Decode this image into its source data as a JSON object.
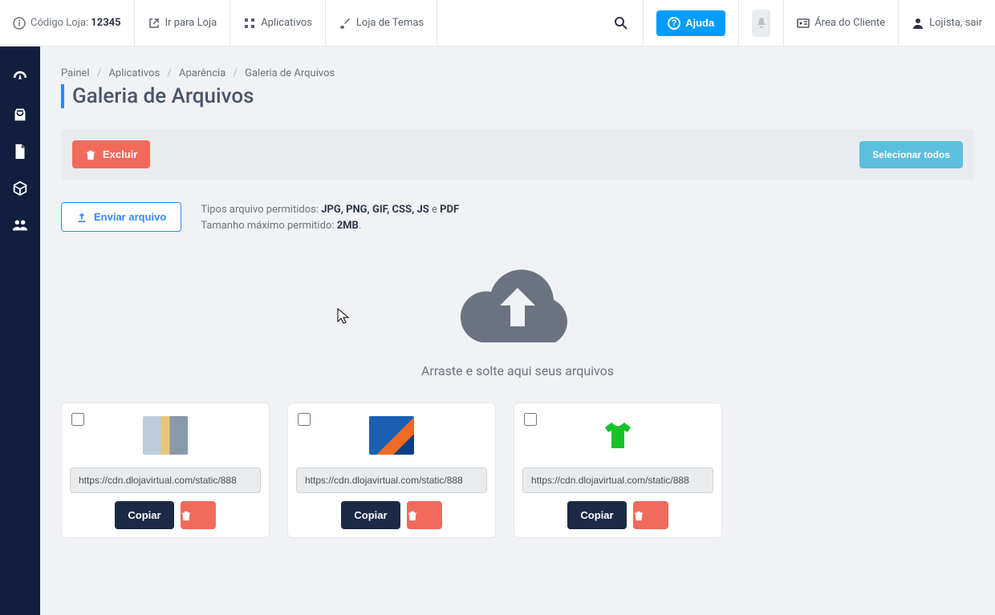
{
  "header": {
    "store_code_label": "Código Loja:",
    "store_code_value": "12345",
    "go_to_store": "Ir para Loja",
    "apps": "Aplicativos",
    "theme_store": "Loja de Temas",
    "help": "Ajuda",
    "client_area": "Área do Cliente",
    "logout": "Lojista, sair"
  },
  "breadcrumb": {
    "items": [
      "Painel",
      "Aplicativos",
      "Aparência",
      "Galeria de Arquivos"
    ]
  },
  "page": {
    "title": "Galeria de Arquivos"
  },
  "toolbar": {
    "delete": "Excluir",
    "select_all": "Selecionar todos"
  },
  "upload": {
    "button": "Enviar arquivo",
    "allowed_label": "Tipos arquivo permitidos:",
    "allowed_types": "JPG, PNG, GIF, CSS, JS",
    "and": "e",
    "allowed_types_last": "PDF",
    "max_label": "Tamanho máximo permitido:",
    "max_value": "2MB"
  },
  "dropzone": {
    "text": "Arraste e solte aqui seus arquivos"
  },
  "files": [
    {
      "url": "https://cdn.dlojavirtual.com/static/888"
    },
    {
      "url": "https://cdn.dlojavirtual.com/static/888"
    },
    {
      "url": "https://cdn.dlojavirtual.com/static/888"
    }
  ],
  "file_actions": {
    "copy": "Copiar"
  }
}
